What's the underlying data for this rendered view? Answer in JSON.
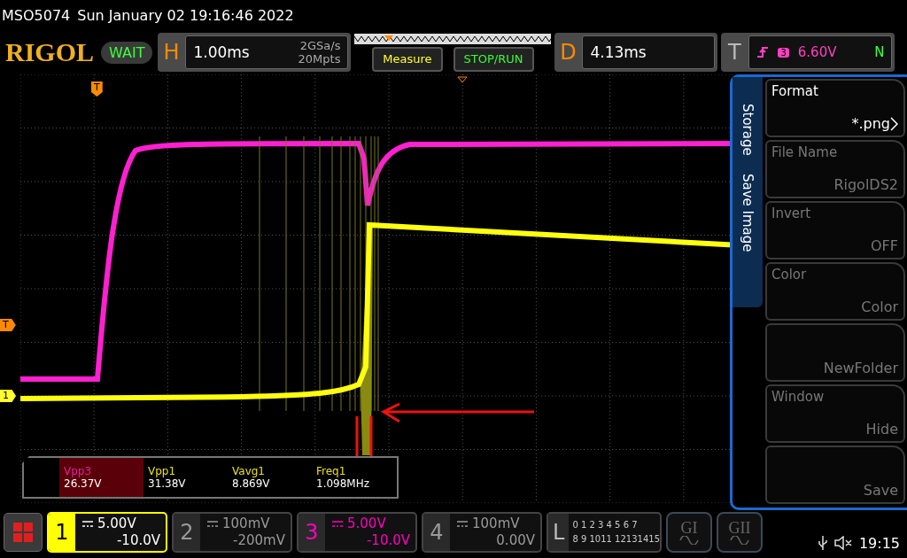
{
  "status_line": {
    "model": "MSO5074",
    "datetime": "Sun January 02 19:16:46 2022"
  },
  "header": {
    "brand": "RIGOL",
    "run_state": "WAIT",
    "horizontal": {
      "label": "H",
      "timebase": "1.00ms",
      "sample_rate": "2GSa/s",
      "memory_depth": "20Mpts"
    },
    "buttons": [
      {
        "label": "Measure",
        "kind": "measure"
      },
      {
        "label": "STOP/RUN",
        "kind": "run"
      }
    ],
    "delay": {
      "label": "D",
      "value": "4.13ms"
    },
    "trigger": {
      "label": "T",
      "source": "3",
      "level": "6.60V",
      "mode": "N"
    }
  },
  "markers": {
    "trigger_time": "T",
    "trigger_level": "T",
    "channel": "1"
  },
  "measurements": [
    {
      "label": "Vpp3",
      "value": "26.37V",
      "color": "#e020a0",
      "selected": true
    },
    {
      "label": "Vpp1",
      "value": "31.38V",
      "color": "#e8e020",
      "selected": false
    },
    {
      "label": "Vavg1",
      "value": "8.869V",
      "color": "#e8e020",
      "selected": false
    },
    {
      "label": "Freq1",
      "value": "1.098MHz",
      "color": "#e8e020",
      "selected": false
    }
  ],
  "menu": {
    "title": "Storage",
    "subtitle": "Save Image",
    "items": [
      {
        "label": "Format",
        "value": "*.png",
        "disabled": false,
        "arrow": true
      },
      {
        "label": "File Name",
        "value": "RigolDS2",
        "disabled": true,
        "arrow": false
      },
      {
        "label": "Invert",
        "value": "OFF",
        "disabled": true,
        "arrow": false
      },
      {
        "label": "Color",
        "value": "Color",
        "disabled": true,
        "arrow": false
      },
      {
        "value": "NewFolder",
        "disabled": true,
        "arrow": false
      },
      {
        "label": "Window",
        "value": "Hide",
        "disabled": true,
        "arrow": false
      },
      {
        "value": "Save",
        "disabled": true,
        "arrow": false
      }
    ]
  },
  "channels": [
    {
      "number": "1",
      "scale": "5.00V",
      "offset": "-10.0V",
      "color": "#ffff00",
      "selected": true
    },
    {
      "number": "2",
      "scale": "100mV",
      "offset": "-200mV",
      "color": "#9a9a9a",
      "selected": false
    },
    {
      "number": "3",
      "scale": "5.00V",
      "offset": "-10.0V",
      "color": "#ff00c0",
      "selected": false
    },
    {
      "number": "4",
      "scale": "100mV",
      "offset": "0.00V",
      "color": "#9a9a9a",
      "selected": false
    }
  ],
  "logic": {
    "label": "L",
    "rows": [
      "0 1 2 3 4 5 6 7",
      "8 9 1011 12131415"
    ]
  },
  "generators": [
    "GI",
    "GII"
  ],
  "status": {
    "time": "19:15"
  }
}
